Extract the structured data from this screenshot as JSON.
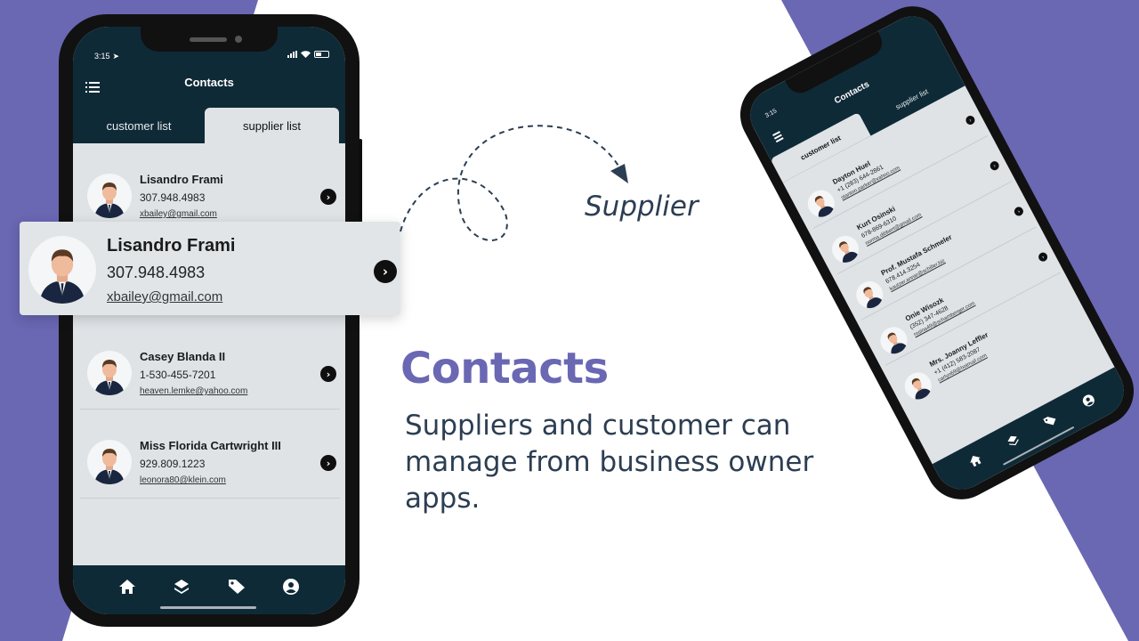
{
  "colors": {
    "accent": "#6a67b3",
    "app_header": "#0f2a37",
    "list_background": "#dfe3e6",
    "text_dark": "#2c3e52"
  },
  "left_phone": {
    "status_time": "3:15",
    "title": "Contacts",
    "tabs": [
      {
        "label": "customer  list",
        "active": false
      },
      {
        "label": "supplier  list",
        "active": true
      }
    ],
    "contacts": [
      {
        "name": "Lisandro Frami",
        "phone": "307.948.4983",
        "email": "xbailey@gmail.com"
      },
      {
        "name": "Casey Blanda II",
        "phone": "1-530-455-7201",
        "email": "heaven.lemke@yahoo.com"
      },
      {
        "name": "Miss Florida Cartwright III",
        "phone": "929.809.1223",
        "email": "leonora80@klein.com"
      }
    ],
    "nav_icons": [
      "home-icon",
      "layers-icon",
      "tag-icon",
      "account-icon"
    ]
  },
  "highlight_card": {
    "name": "Lisandro Frami",
    "phone": "307.948.4983",
    "email": "xbailey@gmail.com"
  },
  "annotation": {
    "label": "Supplier"
  },
  "headline": {
    "title": "Contacts",
    "description": "Suppliers and customer can manage from business owner apps."
  },
  "right_phone": {
    "status_time": "3:15",
    "title": "Contacts",
    "tabs": [
      {
        "label": "customer  list",
        "active": true
      },
      {
        "label": "supplier  list",
        "active": false
      }
    ],
    "contacts": [
      {
        "name": "Dayton Huel",
        "phone": "+1 (283) 644-2861",
        "email": "stanton.parker@yahoo.com"
      },
      {
        "name": "Kurt Osinski",
        "phone": "678-869-6310",
        "email": "norma.dibbert@gmail.com"
      },
      {
        "name": "Prof. Mustafa Schmeler",
        "phone": "678.414.3254",
        "email": "kautzer.annie@schiller.biz"
      },
      {
        "name": "Onie Wisozk",
        "phone": "(352) 347-4628",
        "email": "rosina49@schamberger.com"
      },
      {
        "name": "Mrs. Joanny Leffler",
        "phone": "+1 (412) 583-2087",
        "email": "carlyn69@hotmail.com"
      }
    ],
    "nav_icons": [
      "home-icon",
      "layers-icon",
      "tag-icon",
      "account-icon"
    ]
  }
}
